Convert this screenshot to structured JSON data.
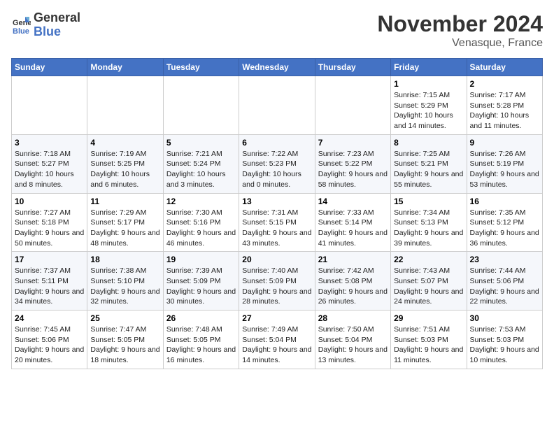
{
  "header": {
    "logo_line1": "General",
    "logo_line2": "Blue",
    "month_title": "November 2024",
    "location": "Venasque, France"
  },
  "weekdays": [
    "Sunday",
    "Monday",
    "Tuesday",
    "Wednesday",
    "Thursday",
    "Friday",
    "Saturday"
  ],
  "weeks": [
    [
      {
        "day": "",
        "info": ""
      },
      {
        "day": "",
        "info": ""
      },
      {
        "day": "",
        "info": ""
      },
      {
        "day": "",
        "info": ""
      },
      {
        "day": "",
        "info": ""
      },
      {
        "day": "1",
        "info": "Sunrise: 7:15 AM\nSunset: 5:29 PM\nDaylight: 10 hours and 14 minutes."
      },
      {
        "day": "2",
        "info": "Sunrise: 7:17 AM\nSunset: 5:28 PM\nDaylight: 10 hours and 11 minutes."
      }
    ],
    [
      {
        "day": "3",
        "info": "Sunrise: 7:18 AM\nSunset: 5:27 PM\nDaylight: 10 hours and 8 minutes."
      },
      {
        "day": "4",
        "info": "Sunrise: 7:19 AM\nSunset: 5:25 PM\nDaylight: 10 hours and 6 minutes."
      },
      {
        "day": "5",
        "info": "Sunrise: 7:21 AM\nSunset: 5:24 PM\nDaylight: 10 hours and 3 minutes."
      },
      {
        "day": "6",
        "info": "Sunrise: 7:22 AM\nSunset: 5:23 PM\nDaylight: 10 hours and 0 minutes."
      },
      {
        "day": "7",
        "info": "Sunrise: 7:23 AM\nSunset: 5:22 PM\nDaylight: 9 hours and 58 minutes."
      },
      {
        "day": "8",
        "info": "Sunrise: 7:25 AM\nSunset: 5:21 PM\nDaylight: 9 hours and 55 minutes."
      },
      {
        "day": "9",
        "info": "Sunrise: 7:26 AM\nSunset: 5:19 PM\nDaylight: 9 hours and 53 minutes."
      }
    ],
    [
      {
        "day": "10",
        "info": "Sunrise: 7:27 AM\nSunset: 5:18 PM\nDaylight: 9 hours and 50 minutes."
      },
      {
        "day": "11",
        "info": "Sunrise: 7:29 AM\nSunset: 5:17 PM\nDaylight: 9 hours and 48 minutes."
      },
      {
        "day": "12",
        "info": "Sunrise: 7:30 AM\nSunset: 5:16 PM\nDaylight: 9 hours and 46 minutes."
      },
      {
        "day": "13",
        "info": "Sunrise: 7:31 AM\nSunset: 5:15 PM\nDaylight: 9 hours and 43 minutes."
      },
      {
        "day": "14",
        "info": "Sunrise: 7:33 AM\nSunset: 5:14 PM\nDaylight: 9 hours and 41 minutes."
      },
      {
        "day": "15",
        "info": "Sunrise: 7:34 AM\nSunset: 5:13 PM\nDaylight: 9 hours and 39 minutes."
      },
      {
        "day": "16",
        "info": "Sunrise: 7:35 AM\nSunset: 5:12 PM\nDaylight: 9 hours and 36 minutes."
      }
    ],
    [
      {
        "day": "17",
        "info": "Sunrise: 7:37 AM\nSunset: 5:11 PM\nDaylight: 9 hours and 34 minutes."
      },
      {
        "day": "18",
        "info": "Sunrise: 7:38 AM\nSunset: 5:10 PM\nDaylight: 9 hours and 32 minutes."
      },
      {
        "day": "19",
        "info": "Sunrise: 7:39 AM\nSunset: 5:09 PM\nDaylight: 9 hours and 30 minutes."
      },
      {
        "day": "20",
        "info": "Sunrise: 7:40 AM\nSunset: 5:09 PM\nDaylight: 9 hours and 28 minutes."
      },
      {
        "day": "21",
        "info": "Sunrise: 7:42 AM\nSunset: 5:08 PM\nDaylight: 9 hours and 26 minutes."
      },
      {
        "day": "22",
        "info": "Sunrise: 7:43 AM\nSunset: 5:07 PM\nDaylight: 9 hours and 24 minutes."
      },
      {
        "day": "23",
        "info": "Sunrise: 7:44 AM\nSunset: 5:06 PM\nDaylight: 9 hours and 22 minutes."
      }
    ],
    [
      {
        "day": "24",
        "info": "Sunrise: 7:45 AM\nSunset: 5:06 PM\nDaylight: 9 hours and 20 minutes."
      },
      {
        "day": "25",
        "info": "Sunrise: 7:47 AM\nSunset: 5:05 PM\nDaylight: 9 hours and 18 minutes."
      },
      {
        "day": "26",
        "info": "Sunrise: 7:48 AM\nSunset: 5:05 PM\nDaylight: 9 hours and 16 minutes."
      },
      {
        "day": "27",
        "info": "Sunrise: 7:49 AM\nSunset: 5:04 PM\nDaylight: 9 hours and 14 minutes."
      },
      {
        "day": "28",
        "info": "Sunrise: 7:50 AM\nSunset: 5:04 PM\nDaylight: 9 hours and 13 minutes."
      },
      {
        "day": "29",
        "info": "Sunrise: 7:51 AM\nSunset: 5:03 PM\nDaylight: 9 hours and 11 minutes."
      },
      {
        "day": "30",
        "info": "Sunrise: 7:53 AM\nSunset: 5:03 PM\nDaylight: 9 hours and 10 minutes."
      }
    ]
  ]
}
